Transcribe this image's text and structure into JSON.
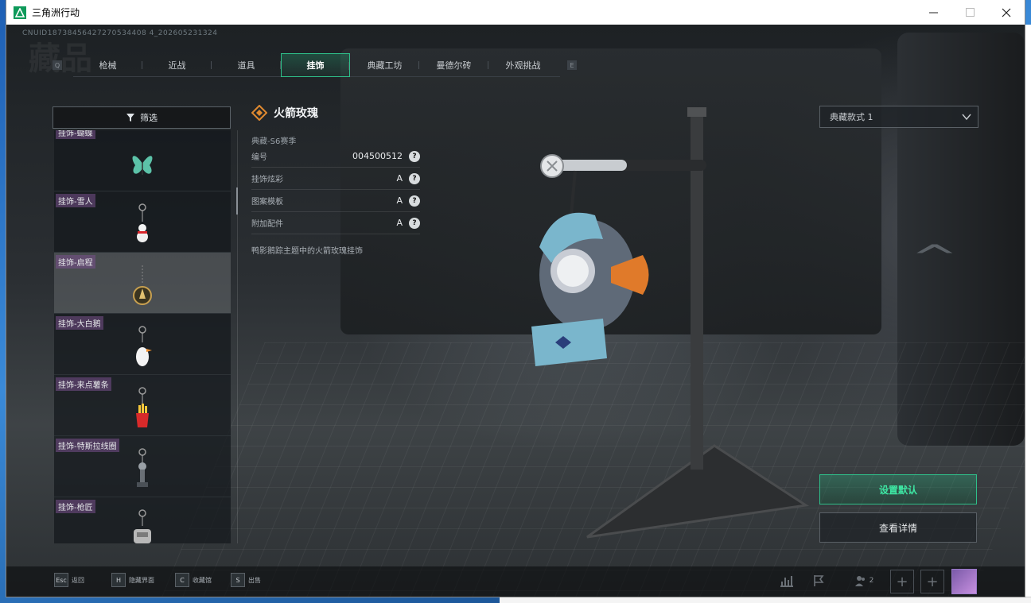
{
  "window": {
    "title": "三角洲行动"
  },
  "uid": "CNUID18738456427270534408 4_202605231324",
  "section_bg_title": "藏品",
  "tabs": [
    {
      "label": "枪械",
      "active": false
    },
    {
      "label": "近战",
      "active": false
    },
    {
      "label": "道具",
      "active": false
    },
    {
      "label": "挂饰",
      "active": true
    },
    {
      "label": "典藏工坊",
      "active": false
    },
    {
      "label": "曼德尔砖",
      "active": false
    },
    {
      "label": "外观挑战",
      "active": false
    }
  ],
  "tab_keys": {
    "left": "Q",
    "right": "E"
  },
  "filter": {
    "label": "筛选",
    "icon": "filter-icon"
  },
  "items": [
    {
      "label": "挂饰-蝴蝶",
      "icon": "butterfly-charm-icon"
    },
    {
      "label": "挂饰-雪人",
      "icon": "snowman-charm-icon"
    },
    {
      "label": "挂饰-启程",
      "icon": "compass-charm-icon",
      "selected": true
    },
    {
      "label": "挂饰-大白鹅",
      "icon": "goose-charm-icon"
    },
    {
      "label": "挂饰-来点薯条",
      "icon": "fries-charm-icon"
    },
    {
      "label": "挂饰-特斯拉线圈",
      "icon": "tesla-coil-charm-icon"
    },
    {
      "label": "挂饰-枪匠",
      "icon": "gunsmith-charm-icon"
    }
  ],
  "detail": {
    "title": "火箭玫瑰",
    "season": "典藏-S6赛季",
    "props": [
      {
        "label": "编号",
        "value": "004500512"
      },
      {
        "label": "挂饰炫彩",
        "value": "A"
      },
      {
        "label": "图案模板",
        "value": "A"
      },
      {
        "label": "附加配件",
        "value": "A"
      }
    ],
    "qmark": "?",
    "desc": "鸭影鹅踪主题中的火箭玫瑰挂饰"
  },
  "variant": {
    "selected": "典藏款式 1"
  },
  "actions": {
    "set_default": "设置默认",
    "view_details": "查看详情"
  },
  "hints": [
    {
      "key": "Esc",
      "label": "返回"
    },
    {
      "key": "H",
      "label": "隐藏界面"
    },
    {
      "key": "C",
      "label": "收藏馆"
    },
    {
      "key": "S",
      "label": "出售"
    }
  ],
  "party": {
    "count": "2"
  },
  "plus": "+",
  "colors": {
    "accent": "#2ec08a",
    "accent_text": "#3ee8a4",
    "label_tag": "#785088"
  }
}
